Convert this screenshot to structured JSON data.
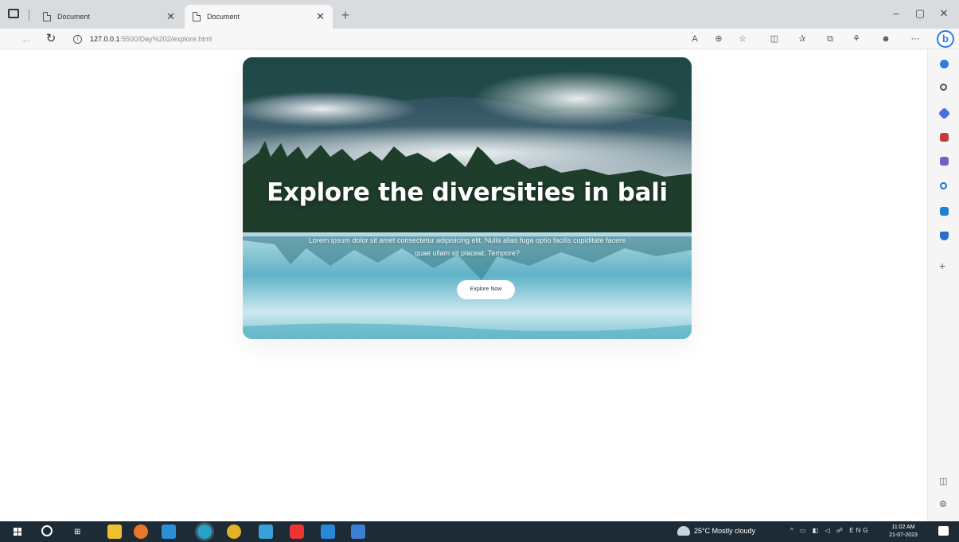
{
  "browser": {
    "tabs": [
      {
        "title": "Document",
        "active": false
      },
      {
        "title": "Document",
        "active": true
      }
    ],
    "new_tab_symbol": "+",
    "window_controls": {
      "minimize": "–",
      "maximize": "▢",
      "close": "✕"
    },
    "url": {
      "host": "127.0.0.1",
      "path": ":5500/Day%202/explore.html"
    },
    "bing_label": "b"
  },
  "page": {
    "hero": {
      "title": "Explore the diversities in bali",
      "text": "Lorem ipsum dolor sit amet consectetur adipisicing elit. Nulla alias fuga optio facilis cupiditate facere quae ullam sit placeat. Tempore?",
      "button_label": "Explore Now"
    }
  },
  "taskbar": {
    "weather": "25°C  Mostly cloudy",
    "tray": "^ ▭ ◧ ◁ ☍ ENG",
    "time": "11:02 AM",
    "date": "21-07-2023"
  },
  "colors": {
    "accent": "#2a7de1",
    "taskbar": "#1d2b36",
    "tabstrip": "#d9dcdf"
  }
}
